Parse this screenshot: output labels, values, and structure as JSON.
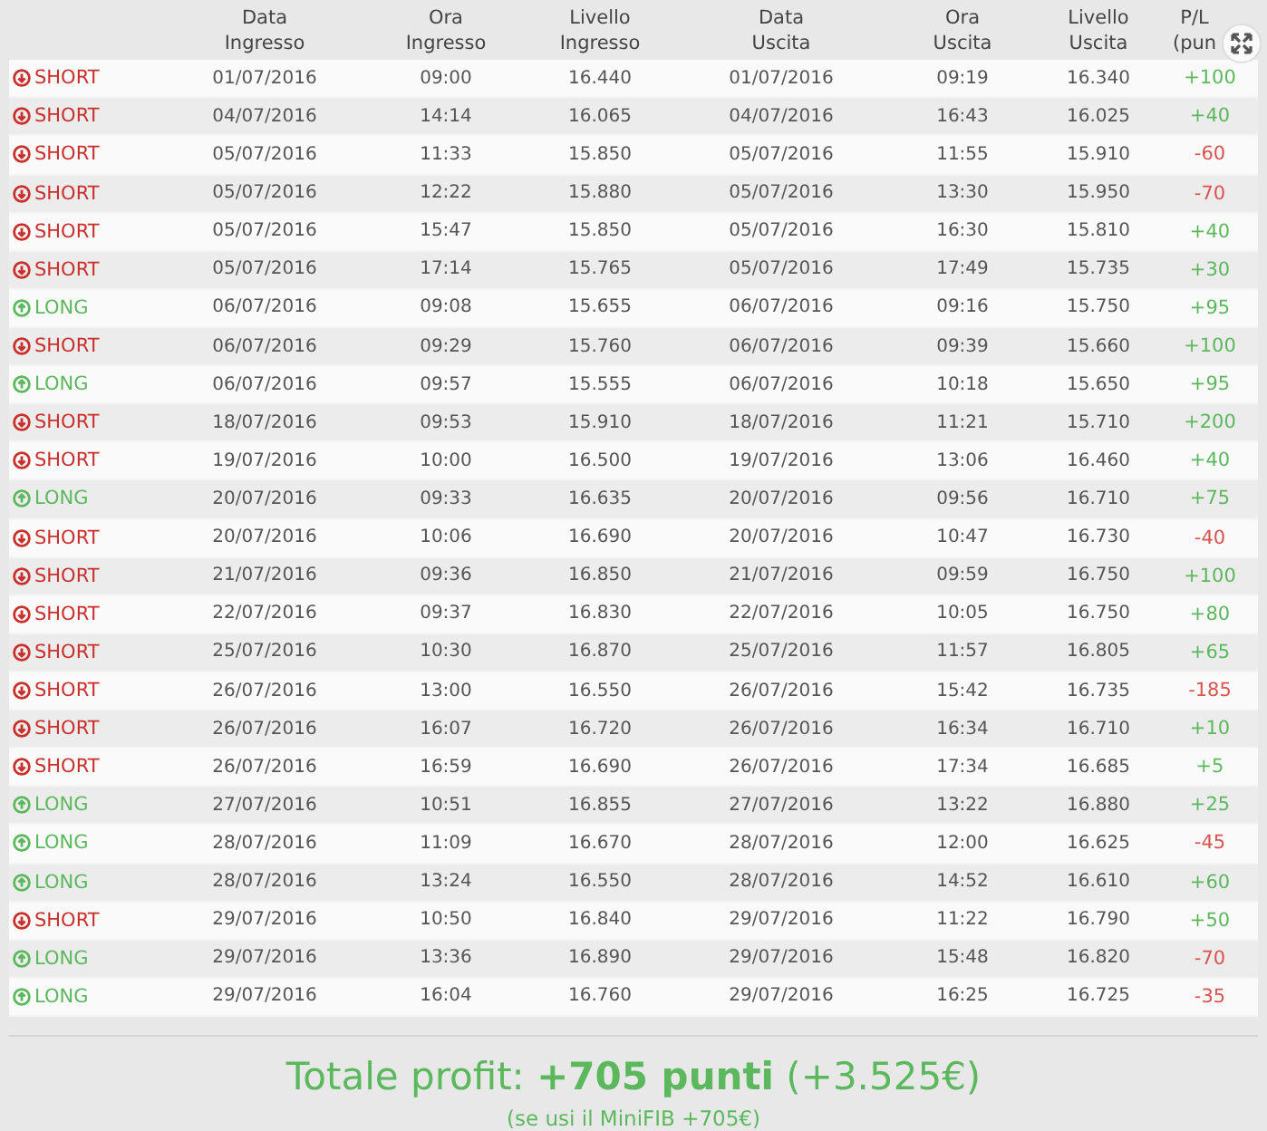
{
  "columns": [
    {},
    {
      "line1": "Data",
      "line2": "Ingresso"
    },
    {
      "line1": "Ora",
      "line2": "Ingresso"
    },
    {
      "line1": "Livello",
      "line2": "Ingresso"
    },
    {
      "line1": "Data",
      "line2": "Uscita"
    },
    {
      "line1": "Ora",
      "line2": "Uscita"
    },
    {
      "line1": "Livello",
      "line2": "Uscita"
    },
    {
      "line1": "P/L",
      "line2": "(pun"
    }
  ],
  "rows": [
    {
      "kind": "short",
      "label": "SHORT",
      "cells": [
        "01/07/2016",
        "09:00",
        "16.440",
        "01/07/2016",
        "09:19",
        "16.340"
      ],
      "pl": "+100",
      "color": "#5cb85c"
    },
    {
      "kind": "short",
      "label": "SHORT",
      "cells": [
        "04/07/2016",
        "14:14",
        "16.065",
        "04/07/2016",
        "16:43",
        "16.025"
      ],
      "pl": "+40",
      "color": "#5cb85c"
    },
    {
      "kind": "short",
      "label": "SHORT",
      "cells": [
        "05/07/2016",
        "11:33",
        "15.850",
        "05/07/2016",
        "11:55",
        "15.910"
      ],
      "pl": "-60",
      "color": "#d9534f"
    },
    {
      "kind": "short",
      "label": "SHORT",
      "cells": [
        "05/07/2016",
        "12:22",
        "15.880",
        "05/07/2016",
        "13:30",
        "15.950"
      ],
      "pl": "-70",
      "color": "#d9534f"
    },
    {
      "kind": "short",
      "label": "SHORT",
      "cells": [
        "05/07/2016",
        "15:47",
        "15.850",
        "05/07/2016",
        "16:30",
        "15.810"
      ],
      "pl": "+40",
      "color": "#5cb85c"
    },
    {
      "kind": "short",
      "label": "SHORT",
      "cells": [
        "05/07/2016",
        "17:14",
        "15.765",
        "05/07/2016",
        "17:49",
        "15.735"
      ],
      "pl": "+30",
      "color": "#5cb85c"
    },
    {
      "kind": "long",
      "label": "LONG",
      "cells": [
        "06/07/2016",
        "09:08",
        "15.655",
        "06/07/2016",
        "09:16",
        "15.750"
      ],
      "pl": "+95",
      "color": "#5cb85c"
    },
    {
      "kind": "short",
      "label": "SHORT",
      "cells": [
        "06/07/2016",
        "09:29",
        "15.760",
        "06/07/2016",
        "09:39",
        "15.660"
      ],
      "pl": "+100",
      "color": "#5cb85c"
    },
    {
      "kind": "long",
      "label": "LONG",
      "cells": [
        "06/07/2016",
        "09:57",
        "15.555",
        "06/07/2016",
        "10:18",
        "15.650"
      ],
      "pl": "+95",
      "color": "#5cb85c"
    },
    {
      "kind": "short",
      "label": "SHORT",
      "cells": [
        "18/07/2016",
        "09:53",
        "15.910",
        "18/07/2016",
        "11:21",
        "15.710"
      ],
      "pl": "+200",
      "color": "#5cb85c"
    },
    {
      "kind": "short",
      "label": "SHORT",
      "cells": [
        "19/07/2016",
        "10:00",
        "16.500",
        "19/07/2016",
        "13:06",
        "16.460"
      ],
      "pl": "+40",
      "color": "#5cb85c"
    },
    {
      "kind": "long",
      "label": "LONG",
      "cells": [
        "20/07/2016",
        "09:33",
        "16.635",
        "20/07/2016",
        "09:56",
        "16.710"
      ],
      "pl": "+75",
      "color": "#5cb85c"
    },
    {
      "kind": "short",
      "label": "SHORT",
      "cells": [
        "20/07/2016",
        "10:06",
        "16.690",
        "20/07/2016",
        "10:47",
        "16.730"
      ],
      "pl": "-40",
      "color": "#d9534f"
    },
    {
      "kind": "short",
      "label": "SHORT",
      "cells": [
        "21/07/2016",
        "09:36",
        "16.850",
        "21/07/2016",
        "09:59",
        "16.750"
      ],
      "pl": "+100",
      "color": "#5cb85c"
    },
    {
      "kind": "short",
      "label": "SHORT",
      "cells": [
        "22/07/2016",
        "09:37",
        "16.830",
        "22/07/2016",
        "10:05",
        "16.750"
      ],
      "pl": "+80",
      "color": "#5cb85c"
    },
    {
      "kind": "short",
      "label": "SHORT",
      "cells": [
        "25/07/2016",
        "10:30",
        "16.870",
        "25/07/2016",
        "11:57",
        "16.805"
      ],
      "pl": "+65",
      "color": "#5cb85c"
    },
    {
      "kind": "short",
      "label": "SHORT",
      "cells": [
        "26/07/2016",
        "13:00",
        "16.550",
        "26/07/2016",
        "15:42",
        "16.735"
      ],
      "pl": "-185",
      "color": "#d9534f"
    },
    {
      "kind": "short",
      "label": "SHORT",
      "cells": [
        "26/07/2016",
        "16:07",
        "16.720",
        "26/07/2016",
        "16:34",
        "16.710"
      ],
      "pl": "+10",
      "color": "#5cb85c"
    },
    {
      "kind": "short",
      "label": "SHORT",
      "cells": [
        "26/07/2016",
        "16:59",
        "16.690",
        "26/07/2016",
        "17:34",
        "16.685"
      ],
      "pl": "+5",
      "color": "#5cb85c"
    },
    {
      "kind": "long",
      "label": "LONG",
      "cells": [
        "27/07/2016",
        "10:51",
        "16.855",
        "27/07/2016",
        "13:22",
        "16.880"
      ],
      "pl": "+25",
      "color": "#5cb85c"
    },
    {
      "kind": "long",
      "label": "LONG",
      "cells": [
        "28/07/2016",
        "11:09",
        "16.670",
        "28/07/2016",
        "12:00",
        "16.625"
      ],
      "pl": "-45",
      "color": "#d9534f"
    },
    {
      "kind": "long",
      "label": "LONG",
      "cells": [
        "28/07/2016",
        "13:24",
        "16.550",
        "28/07/2016",
        "14:52",
        "16.610"
      ],
      "pl": "+60",
      "color": "#5cb85c"
    },
    {
      "kind": "short",
      "label": "SHORT",
      "cells": [
        "29/07/2016",
        "10:50",
        "16.840",
        "29/07/2016",
        "11:22",
        "16.790"
      ],
      "pl": "+50",
      "color": "#5cb85c"
    },
    {
      "kind": "long",
      "label": "LONG",
      "cells": [
        "29/07/2016",
        "13:36",
        "16.890",
        "29/07/2016",
        "15:48",
        "16.820"
      ],
      "pl": "-70",
      "color": "#d9534f"
    },
    {
      "kind": "long",
      "label": "LONG",
      "cells": [
        "29/07/2016",
        "16:04",
        "16.760",
        "29/07/2016",
        "16:25",
        "16.725"
      ],
      "pl": "-35",
      "color": "#d9534f"
    }
  ],
  "total": "Totale profit: **+705 punti** (+3.525€)",
  "note": "(se usi il MiniFIB +705€)"
}
